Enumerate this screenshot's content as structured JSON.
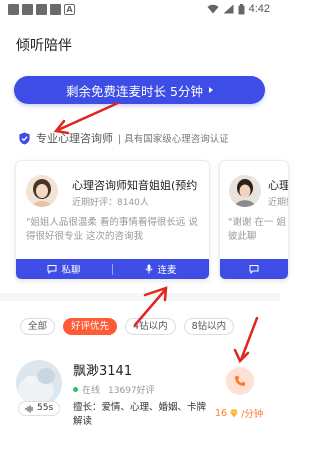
{
  "status_bar": {
    "time": "4:42"
  },
  "page": {
    "title": "倾听陪伴"
  },
  "banner": {
    "label": "剩余免费连麦时长 5分钟"
  },
  "certification": {
    "title": "专业心理咨询师",
    "subtitle": "| 具有国家级心理咨询认证"
  },
  "cards": [
    {
      "name": "心理咨询师知音姐姐(预约",
      "rating": "近期好评：8140人",
      "quote": "\"姐姐人品很温柔 看的事情看得很长远 说得很好很专业 这次的咨询我",
      "chat_label": "私聊",
      "voice_label": "连麦"
    },
    {
      "name": "心理咨询",
      "rating": "近期好评",
      "quote": "\"谢谢 在一 姐 彼此聊"
    }
  ],
  "filters": [
    {
      "label": "全部",
      "active": false
    },
    {
      "label": "好评优先",
      "active": true
    },
    {
      "label": "4钻以内",
      "active": false
    },
    {
      "label": "8钻以内",
      "active": false
    }
  ],
  "counselor": {
    "name": "飘渺3141",
    "voice_duration": "55s",
    "status": "在线",
    "reviews": "13697好评",
    "tags": "擅长：爱情、心理、婚姻、卡牌解读",
    "price_amount": "16",
    "price_unit": "/分钟"
  },
  "colors": {
    "accent": "#3d4de6",
    "orange": "#ff5a36",
    "annotation_red": "#e0261f"
  }
}
